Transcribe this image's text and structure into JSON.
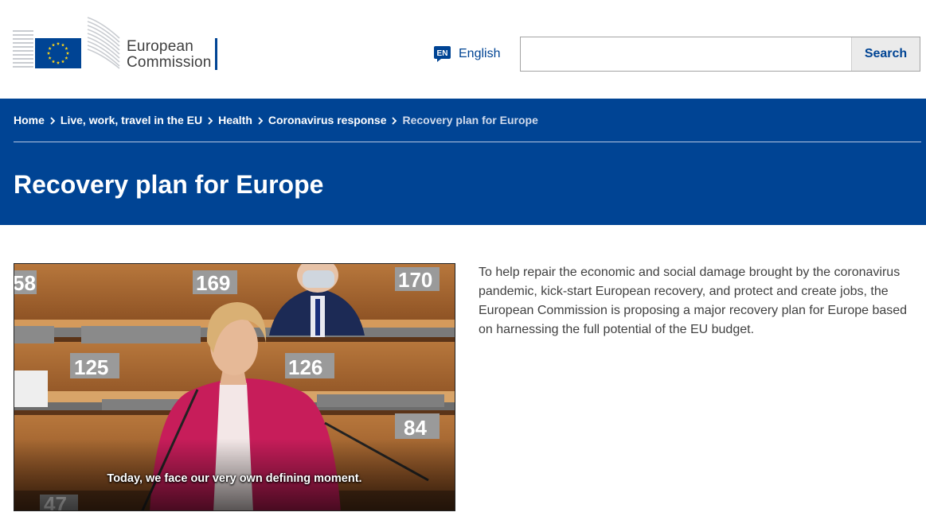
{
  "header": {
    "logo_line1": "European",
    "logo_line2": "Commission",
    "language_code": "EN",
    "language_label": "English",
    "search": {
      "value": "",
      "placeholder": "",
      "button_label": "Search"
    }
  },
  "breadcrumb": [
    {
      "label": "Home"
    },
    {
      "label": "Live, work, travel in the EU"
    },
    {
      "label": "Health"
    },
    {
      "label": "Coronavirus response"
    },
    {
      "label": "Recovery plan for Europe"
    }
  ],
  "page_title": "Recovery plan for Europe",
  "video": {
    "caption": "Today, we face our very own defining moment.",
    "seat_numbers": [
      "58",
      "169",
      "170",
      "125",
      "126",
      "84",
      "47"
    ]
  },
  "intro_text": "To help repair the economic and social damage brought by the coronavirus pandemic, kick-start European recovery, and protect and create jobs, the European Commission is proposing a major recovery plan for Europe based on harnessing the full potential of the EU budget.",
  "colors": {
    "brand_blue": "#004494",
    "eu_yellow": "#ffd617",
    "text": "#404040"
  }
}
